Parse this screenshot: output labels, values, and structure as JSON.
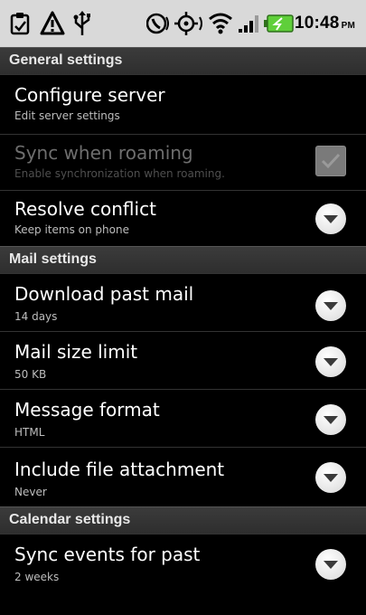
{
  "status_bar": {
    "time": "10:48",
    "ampm": "PM",
    "icons": [
      "clipboard-icon",
      "warning-icon",
      "usb-icon",
      "phone-alert-icon",
      "gps-icon",
      "wifi-icon",
      "signal-icon",
      "battery-icon"
    ],
    "battery_color": "#5fcf3a"
  },
  "sections": {
    "general": "General settings",
    "mail": "Mail settings",
    "calendar": "Calendar settings"
  },
  "items": {
    "configure_server": {
      "title": "Configure server",
      "summary": "Edit server settings"
    },
    "sync_roaming": {
      "title": "Sync when roaming",
      "summary": "Enable synchronization when roaming."
    },
    "resolve_conflict": {
      "title": "Resolve conflict",
      "summary": "Keep items on phone"
    },
    "download_past_mail": {
      "title": "Download past mail",
      "summary": "14 days"
    },
    "mail_size_limit": {
      "title": "Mail size limit",
      "summary": "50 KB"
    },
    "message_format": {
      "title": "Message format",
      "summary": "HTML"
    },
    "include_attachment": {
      "title": "Include file attachment",
      "summary": "Never"
    },
    "sync_events_past": {
      "title": "Sync events for past",
      "summary": "2 weeks"
    }
  }
}
